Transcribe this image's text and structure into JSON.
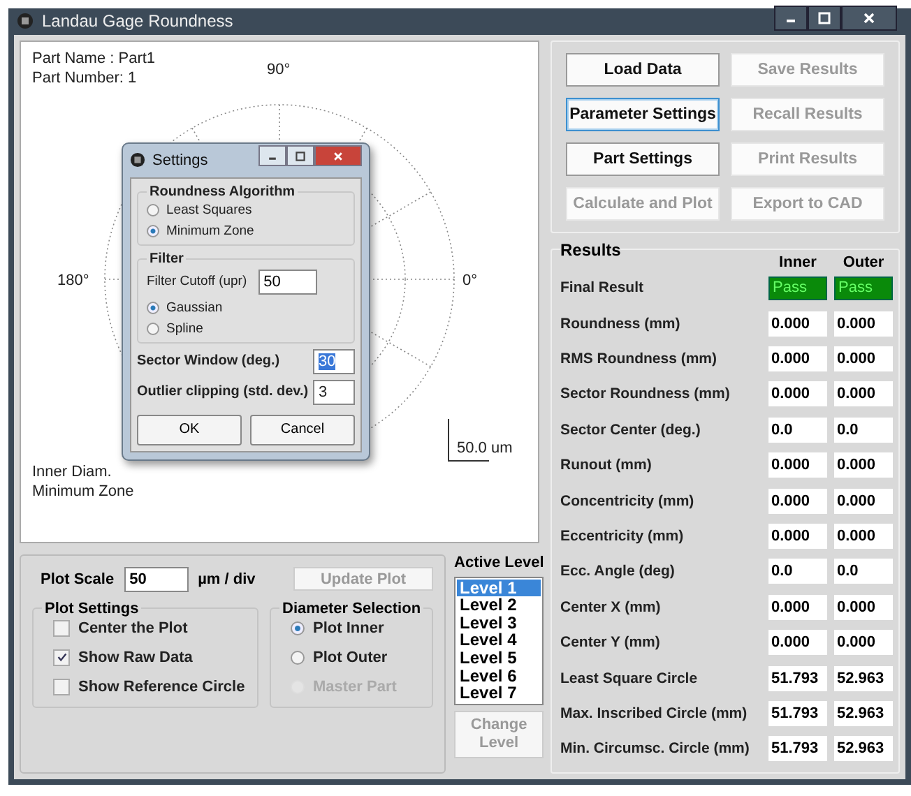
{
  "window": {
    "title": "Landau Gage Roundness"
  },
  "plot": {
    "part_name": "Part Name  : Part1",
    "part_number": "Part Number: 1",
    "angle_labels": [
      "90°",
      "180°",
      "0°"
    ],
    "scale_label": "50.0 um",
    "legend": [
      "Inner Diam.",
      "Minimum Zone"
    ]
  },
  "settings_dialog": {
    "title": "Settings",
    "roundness_algorithm": {
      "title": "Roundness Algorithm",
      "options": [
        {
          "label": "Least Squares",
          "selected": false
        },
        {
          "label": "Minimum Zone",
          "selected": true
        }
      ]
    },
    "filter": {
      "title": "Filter",
      "cutoff_label": "Filter Cutoff (upr)",
      "cutoff_value": "50",
      "options": [
        {
          "label": "Gaussian",
          "selected": true
        },
        {
          "label": "Spline",
          "selected": false
        }
      ]
    },
    "sector_window": {
      "label": "Sector Window (deg.)",
      "value": "30",
      "text_selected": true
    },
    "outlier_clipping": {
      "label": "Outlier clipping (std. dev.)",
      "value": "3",
      "text_selected": false
    },
    "buttons": [
      "OK",
      "Cancel"
    ]
  },
  "actions": [
    {
      "label": "Load Data",
      "disabled": false,
      "focused": false
    },
    {
      "label": "Save Results",
      "disabled": true,
      "focused": false
    },
    {
      "label": "Parameter Settings",
      "disabled": false,
      "focused": true
    },
    {
      "label": "Recall Results",
      "disabled": true,
      "focused": false
    },
    {
      "label": "Part Settings",
      "disabled": false,
      "focused": false
    },
    {
      "label": "Print Results",
      "disabled": true,
      "focused": false
    },
    {
      "label": "Calculate and Plot",
      "disabled": true,
      "focused": false
    },
    {
      "label": "Export to CAD",
      "disabled": true,
      "focused": false
    }
  ],
  "results": {
    "title": "Results",
    "columns": [
      "Inner",
      "Outer"
    ],
    "rows": [
      {
        "label": "Final Result",
        "kind": "status",
        "inner": "Pass",
        "outer": "Pass"
      },
      {
        "label": "Roundness (mm)",
        "kind": "value",
        "inner": "0.000",
        "outer": "0.000"
      },
      {
        "label": "RMS Roundness (mm)",
        "kind": "value",
        "inner": "0.000",
        "outer": "0.000"
      },
      {
        "label": "Sector Roundness (mm)",
        "kind": "value",
        "inner": "0.000",
        "outer": "0.000"
      },
      {
        "label": "Sector Center (deg.)",
        "kind": "value",
        "inner": "0.0",
        "outer": "0.0"
      },
      {
        "label": "Runout (mm)",
        "kind": "value",
        "inner": "0.000",
        "outer": "0.000"
      },
      {
        "label": "Concentricity (mm)",
        "kind": "value",
        "inner": "0.000",
        "outer": "0.000"
      },
      {
        "label": "Eccentricity (mm)",
        "kind": "value",
        "inner": "0.000",
        "outer": "0.000"
      },
      {
        "label": "Ecc. Angle (deg)",
        "kind": "value",
        "inner": "0.0",
        "outer": "0.0"
      },
      {
        "label": "Center X (mm)",
        "kind": "value",
        "inner": "0.000",
        "outer": "0.000"
      },
      {
        "label": "Center Y (mm)",
        "kind": "value",
        "inner": "0.000",
        "outer": "0.000"
      },
      {
        "label": "Least Square Circle",
        "kind": "value",
        "inner": "51.793",
        "outer": "52.963"
      },
      {
        "label": "Max. Inscribed Circle (mm)",
        "kind": "value",
        "inner": "51.793",
        "outer": "52.963"
      },
      {
        "label": "Min. Circumsc. Circle (mm)",
        "kind": "value",
        "inner": "51.793",
        "outer": "52.963"
      }
    ]
  },
  "plot_scale": {
    "label": "Plot Scale",
    "value": "50",
    "unit": "µm / div",
    "button": {
      "label": "Update Plot",
      "disabled": true
    }
  },
  "plot_settings": {
    "title": "Plot Settings",
    "options": [
      {
        "label": "Center the Plot",
        "checked": false
      },
      {
        "label": "Show Raw Data",
        "checked": true
      },
      {
        "label": "Show Reference Circle",
        "checked": false
      }
    ]
  },
  "diameter_selection": {
    "title": "Diameter Selection",
    "options": [
      {
        "label": "Plot Inner",
        "selected": true,
        "disabled": false
      },
      {
        "label": "Plot Outer",
        "selected": false,
        "disabled": false
      },
      {
        "label": "Master Part",
        "selected": false,
        "disabled": true
      }
    ]
  },
  "active_level": {
    "title": "Active Level",
    "levels": [
      {
        "label": "Level 1",
        "selected": true
      },
      {
        "label": "Level 2",
        "selected": false
      },
      {
        "label": "Level 3",
        "selected": false
      },
      {
        "label": "Level 4",
        "selected": false
      },
      {
        "label": "Level 5",
        "selected": false
      },
      {
        "label": "Level 6",
        "selected": false
      },
      {
        "label": "Level 7",
        "selected": false
      }
    ],
    "button": {
      "label": "Change Level",
      "disabled": true
    }
  }
}
